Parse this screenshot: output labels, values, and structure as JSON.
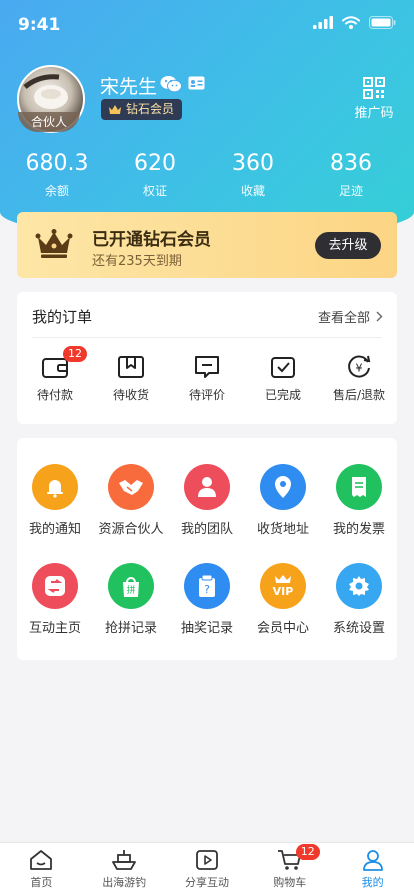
{
  "status_bar": {
    "time": "9:41"
  },
  "profile": {
    "avatar_badge": "合伙人",
    "name": "宋先生",
    "member_level": "钻石会员",
    "qr_label": "推广码"
  },
  "stats": [
    {
      "value": "680.3",
      "label": "余额"
    },
    {
      "value": "620",
      "label": "权证"
    },
    {
      "value": "360",
      "label": "收藏"
    },
    {
      "value": "836",
      "label": "足迹"
    }
  ],
  "vip_card": {
    "title": "已开通钻石会员",
    "subtitle": "还有235天到期",
    "button": "去升级"
  },
  "orders": {
    "title": "我的订单",
    "view_all": "查看全部",
    "items": [
      {
        "label": "待付款",
        "icon": "wallet-icon",
        "badge": "12"
      },
      {
        "label": "待收货",
        "icon": "package-icon"
      },
      {
        "label": "待评价",
        "icon": "comment-icon"
      },
      {
        "label": "已完成",
        "icon": "completed-icon"
      },
      {
        "label": "售后/退款",
        "icon": "refund-icon"
      }
    ]
  },
  "services": [
    {
      "label": "我的通知",
      "icon": "bell-icon",
      "color": "#f7a21b"
    },
    {
      "label": "资源合伙人",
      "icon": "handshake-icon",
      "color": "#f76b3c"
    },
    {
      "label": "我的团队",
      "icon": "team-icon",
      "color": "#ee4d5c"
    },
    {
      "label": "收货地址",
      "icon": "location-icon",
      "color": "#2f8cf0"
    },
    {
      "label": "我的发票",
      "icon": "invoice-icon",
      "color": "#22c160"
    },
    {
      "label": "互动主页",
      "icon": "interaction-icon",
      "color": "#ee4d5c"
    },
    {
      "label": "抢拼记录",
      "icon": "group-buy-icon",
      "color": "#22c160"
    },
    {
      "label": "抽奖记录",
      "icon": "lottery-icon",
      "color": "#2f8cf0"
    },
    {
      "label": "会员中心",
      "icon": "vip-icon",
      "color": "#f7a21b"
    },
    {
      "label": "系统设置",
      "icon": "settings-icon",
      "color": "#36a7f0"
    }
  ],
  "tabbar": {
    "items": [
      {
        "label": "首页",
        "icon": "home-icon"
      },
      {
        "label": "出海游钓",
        "icon": "boat-icon"
      },
      {
        "label": "分享互动",
        "icon": "video-icon"
      },
      {
        "label": "购物车",
        "icon": "cart-icon",
        "badge": "12"
      },
      {
        "label": "我的",
        "icon": "user-icon",
        "active": true
      }
    ],
    "active_color": "#1c8ee6"
  }
}
